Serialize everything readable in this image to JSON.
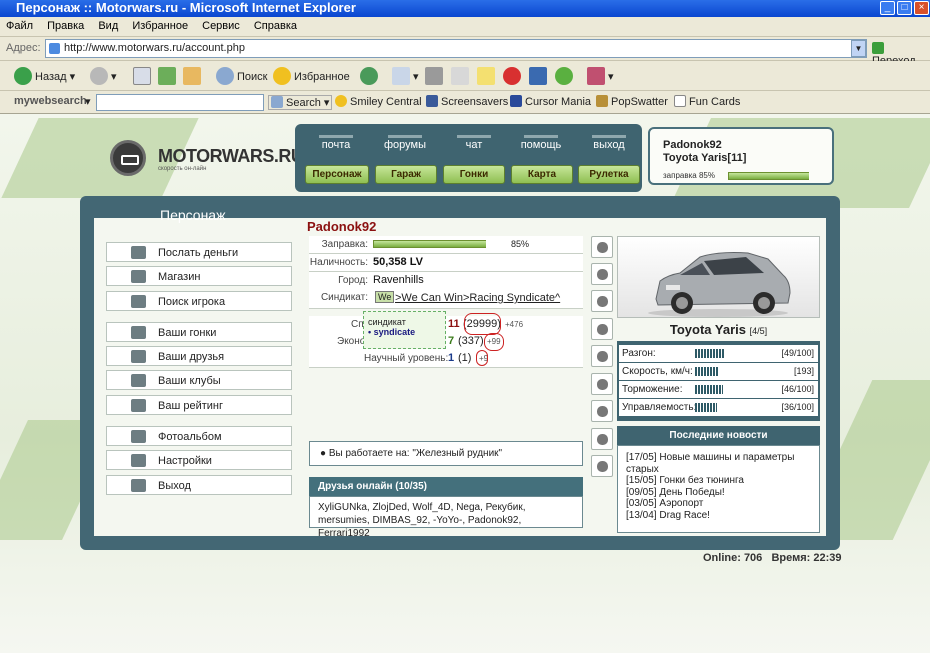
{
  "window": {
    "title": "Персонаж :: Motorwars.ru - Microsoft Internet Explorer"
  },
  "menubar": [
    "Файл",
    "Правка",
    "Вид",
    "Избранное",
    "Сервис",
    "Справка"
  ],
  "address": {
    "label": "Адрес:",
    "url": "http://www.motorwars.ru/account.php",
    "go": "Переход"
  },
  "toolbar": {
    "back": "Назад",
    "search": "Поиск",
    "favorites": "Избранное"
  },
  "searchbar": {
    "brand": "mywebsearch",
    "search_btn": "Search",
    "links": [
      "Smiley Central",
      "Screensavers",
      "Cursor Mania",
      "PopSwatter",
      "Fun Cards"
    ]
  },
  "site": {
    "logo_name": "MOTORWARS.RU",
    "logo_sub": "скорость он-лайн",
    "nav_top": [
      "почта",
      "форумы",
      "чат",
      "помощь",
      "выход"
    ],
    "nav_buttons": [
      "Персонаж",
      "Гараж",
      "Гонки",
      "Карта",
      "Рулетка"
    ],
    "profile": {
      "name": "Padonok92",
      "car": "Toyota Yaris[11]",
      "fuel_label": "заправка 85%",
      "fuel": 0.85
    }
  },
  "section_title": "Персонаж",
  "left_menu": [
    "Послать деньги",
    "Магазин",
    "Поиск игрока",
    "Ваши гонки",
    "Ваши друзья",
    "Ваши клубы",
    "Ваш рейтинг",
    "Фотоальбом",
    "Настройки",
    "Выход"
  ],
  "player": {
    "name": "Padonok92",
    "fuel_label": "Заправка:",
    "fuel_pct": "85%",
    "fuel": 0.85,
    "cash_label": "Наличность:",
    "cash": "50,358 LV",
    "city_label": "Город:",
    "city": "Ravenhills",
    "syndicate_label": "Синдикат:",
    "syndicate_badge": "We",
    "syndicate": ">We Can Win>Racing Syndicate^",
    "sport_label": "Сп",
    "sport_level": "11",
    "sport_pts": "(29999)",
    "sport_delta": "+476",
    "econ_label": "Эконо",
    "econ_level": "7",
    "econ_pts": "(337)",
    "econ_delta": "+99",
    "sci_label": "Научный уровень:",
    "sci_level": "1",
    "sci_pts": "(1)",
    "sci_delta": "+9"
  },
  "tooltip": {
    "line1": "синдикат",
    "line2": "• syndicate"
  },
  "work": "Вы работаете на: \"Железный рудник\"",
  "friends": {
    "title": "Друзья онлайн (10/35)",
    "list": "XyliGUNka, ZlojDed, Wolf_4D, Nega, Рекубик, mersumies, DIMBAS_92, -YoYo-, Padonok92, Ferrari1992"
  },
  "car": {
    "name": "Toyota Yaris",
    "class": "[4/5]",
    "stats": [
      {
        "label": "Разгон:",
        "value": "[49/100]",
        "level": 0.49
      },
      {
        "label": "Скорость, км/ч:",
        "value": "[193]",
        "level": 0.4
      },
      {
        "label": "Торможение:",
        "value": "[46/100]",
        "level": 0.46
      },
      {
        "label": "Управляемость:",
        "value": "[36/100]",
        "level": 0.36
      }
    ]
  },
  "news": {
    "title": "Последние новости",
    "items": [
      "[17/05] Новые машины и параметры старых",
      "[15/05] Гонки без тюнинга",
      "[09/05] День Победы!",
      "[03/05] Аэропорт",
      "[13/04] Drag Race!"
    ]
  },
  "footer": {
    "online": "Online: 706",
    "time": "Время: 22:39"
  }
}
